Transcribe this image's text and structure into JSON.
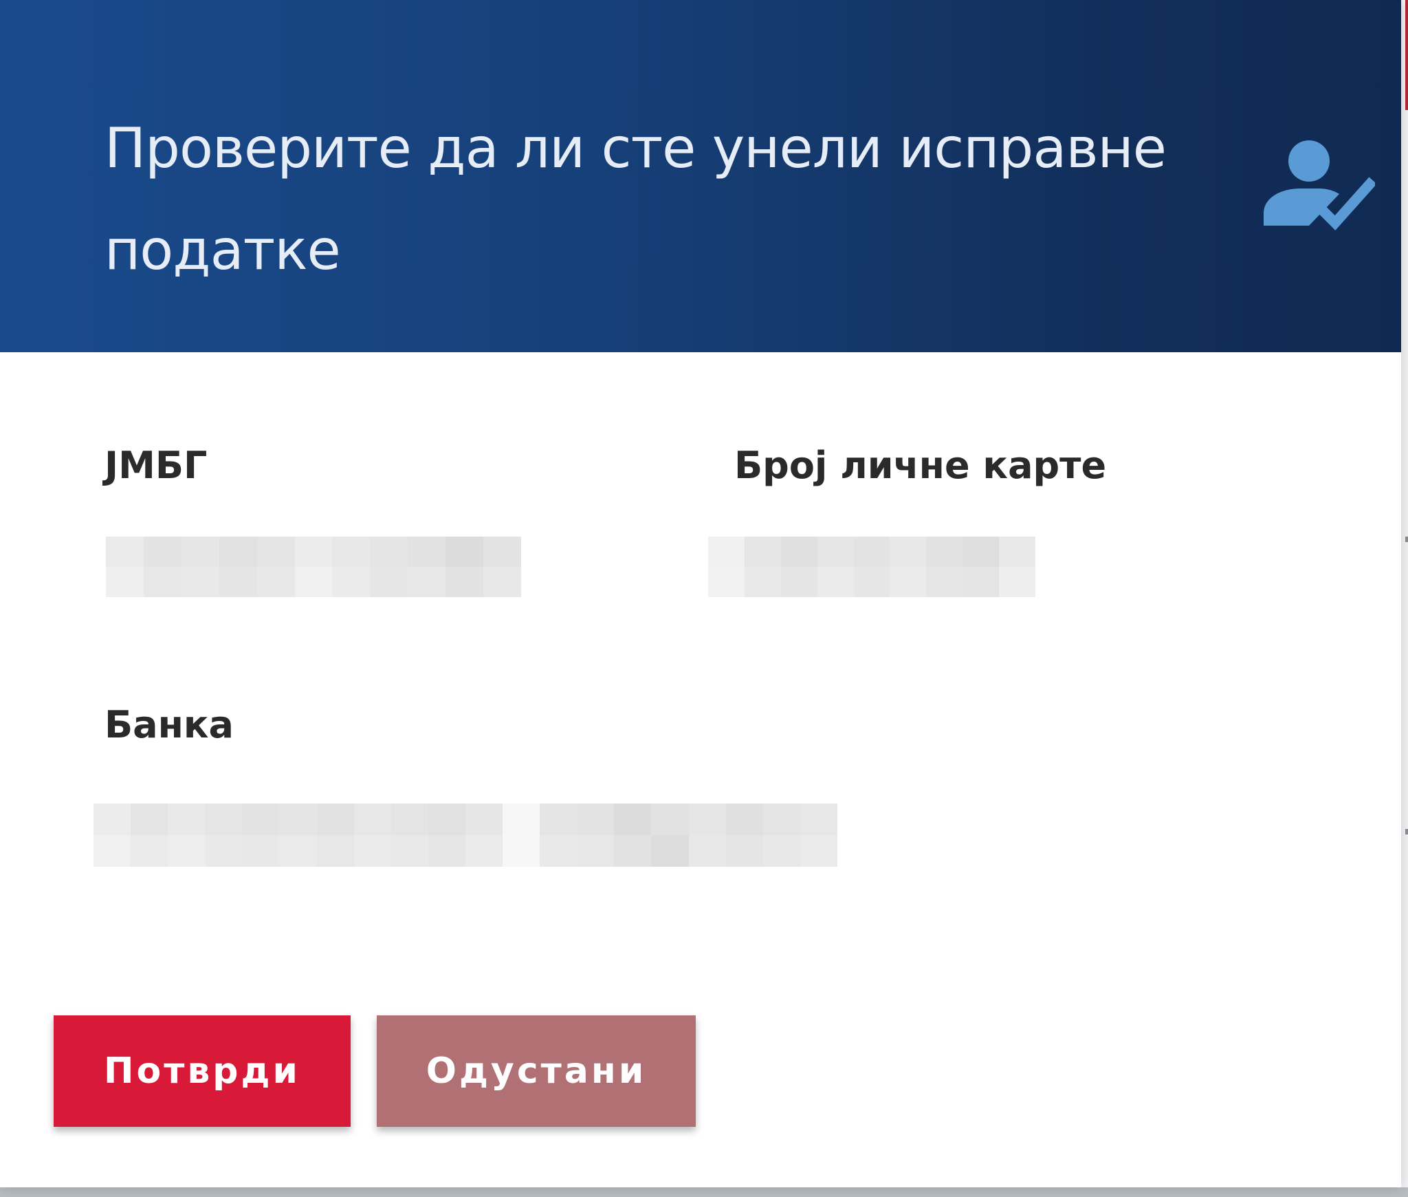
{
  "dialog": {
    "title": "Проверите да ли сте унели исправне податке",
    "icon": "user-check-icon"
  },
  "fields": {
    "jmbg_label": "ЈМБГ",
    "id_card_label": "Број личне карте",
    "bank_label": "Банка"
  },
  "buttons": {
    "confirm_label": "Потврди",
    "cancel_label": "Одустани"
  },
  "colors": {
    "header": "#1a4a8c",
    "icon": "#5b9bd5",
    "confirm": "#d81a38",
    "cancel": "#b07074"
  }
}
